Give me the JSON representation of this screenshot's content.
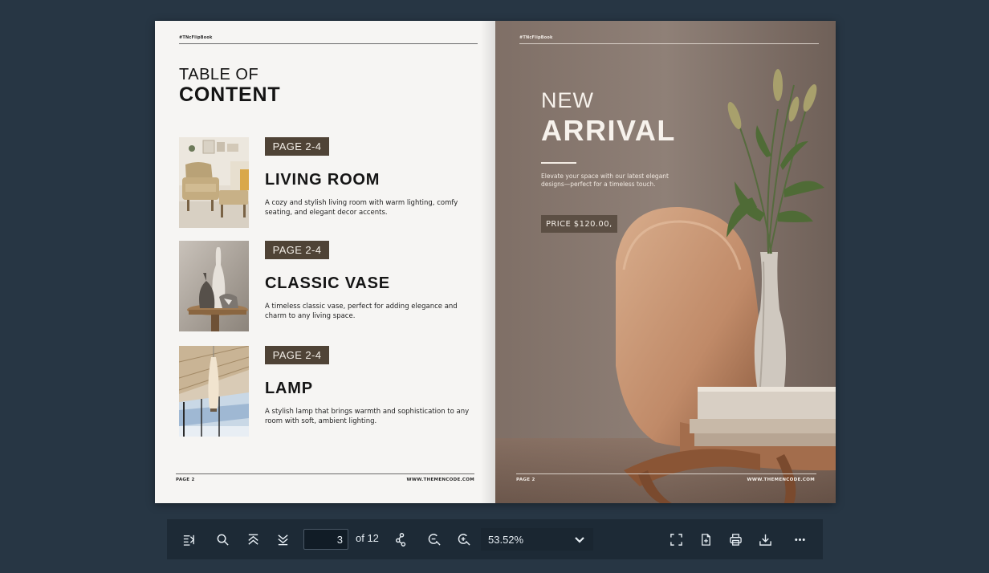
{
  "left_page": {
    "hashtag": "#TNcFlipBook",
    "title_line1": "TABLE OF",
    "title_line2": "CONTENT",
    "items": [
      {
        "badge": "PAGE 2-4",
        "title": "LIVING ROOM",
        "desc": "A cozy and stylish living room with warm lighting, comfy seating, and elegant decor accents."
      },
      {
        "badge": "PAGE 2-4",
        "title": "CLASSIC VASE",
        "desc": "A timeless classic vase, perfect for adding elegance and charm to any living space."
      },
      {
        "badge": "PAGE 2-4",
        "title": "LAMP",
        "desc": "A stylish lamp that brings warmth and sophistication to any room with soft, ambient lighting."
      }
    ],
    "footer_left": "PAGE 2",
    "footer_right": "WWW.THEMENCODE.COM"
  },
  "right_page": {
    "hashtag": "#TNcFlipBook",
    "title_line1": "NEW",
    "title_line2": "ARRIVAL",
    "desc": "Elevate your space with our latest elegant designs—perfect for a timeless touch.",
    "price": "PRICE $120.00,",
    "footer_left": "PAGE 2",
    "footer_right": "WWW.THEMENCODE.COM"
  },
  "toolbar": {
    "icons": {
      "sidebar": "sidebar-toggle-icon",
      "search": "search-icon",
      "first": "first-page-icon",
      "last": "last-page-icon",
      "share": "share-icon",
      "zoom_out": "zoom-out-icon",
      "zoom_in": "zoom-in-icon",
      "fullscreen": "fullscreen-icon",
      "download_pdf": "file-add-icon",
      "print": "print-icon",
      "download": "download-icon",
      "more": "more-icon"
    },
    "current_page": "3",
    "of_label": "of 12",
    "zoom": "53.52%"
  },
  "colors": {
    "background": "#273644",
    "badge": "#4f4336",
    "toolbar": "#1d2a36"
  }
}
